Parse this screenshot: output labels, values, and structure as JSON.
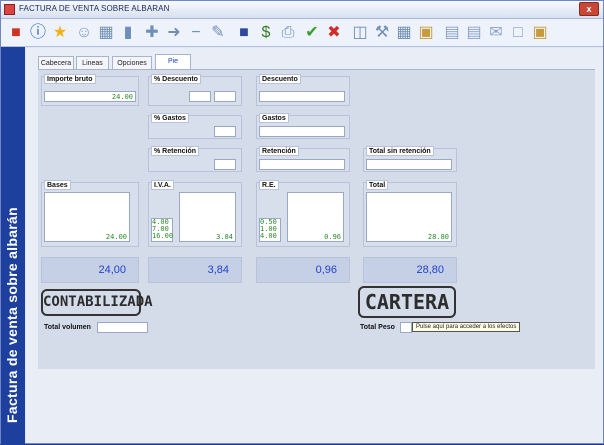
{
  "window": {
    "title": "FACTURA DE VENTA SOBRE ALBARAN",
    "close": "x"
  },
  "sidebar": {
    "text": "Factura de venta sobre albarán"
  },
  "tabs": [
    {
      "label": "Cabecera"
    },
    {
      "label": "Lineas"
    },
    {
      "label": "Opciones"
    },
    {
      "label": "Pie"
    }
  ],
  "fields": {
    "importe_bruto": {
      "label": "Importe bruto",
      "value": "24.00"
    },
    "pct_descuento": {
      "label": "% Descuento",
      "value1": "",
      "value2": ""
    },
    "descuento": {
      "label": "Descuento",
      "value": ""
    },
    "pct_gastos": {
      "label": "% Gastos",
      "value": ""
    },
    "gastos": {
      "label": "Gastos",
      "value": ""
    },
    "pct_retencion": {
      "label": "% Retención",
      "value": ""
    },
    "retencion": {
      "label": "Retención",
      "value": ""
    },
    "total_sin_retencion": {
      "label": "Total sin retención",
      "value": ""
    }
  },
  "bases": {
    "label": "Bases",
    "value": "24.00",
    "total": "24,00"
  },
  "iva": {
    "label": "I.V.A.",
    "rates": [
      "4.00",
      "7.00",
      "16.00"
    ],
    "value": "3.84",
    "total": "3,84"
  },
  "re": {
    "label": "R.E.",
    "rates": [
      "0.50",
      "1.00",
      "4.00"
    ],
    "value": "0.96",
    "total": "0,96"
  },
  "total": {
    "label": "Total",
    "value": "28.80",
    "total": "28,80"
  },
  "stamps": {
    "left": "CONTABILIZADA",
    "right": "CARTERA"
  },
  "footer": {
    "total_volumen": {
      "label": "Total volumen",
      "value": ""
    },
    "total_peso": {
      "label": "Total Peso",
      "value": ""
    },
    "tooltip": "Pulse aquí para acceder a los efectos"
  },
  "colors": {
    "sidebar": "#1d3f9e",
    "accent": "#2442c9",
    "value_green": "#2b8a2b"
  }
}
